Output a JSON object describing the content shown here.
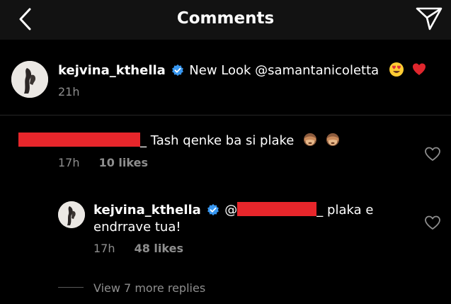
{
  "header": {
    "title": "Comments"
  },
  "caption": {
    "username": "kejvina_kthella",
    "text": "New Look @samantanicoletta",
    "time": "21h"
  },
  "comment": {
    "text_suffix": "_ Tash qenke ba si plake",
    "time": "17h",
    "likes": "10 likes"
  },
  "reply": {
    "username": "kejvina_kthella",
    "mention_prefix": "@",
    "text_suffix": "_ plaka e",
    "text_line2": "endrrave tua!",
    "time": "17h",
    "likes": "48 likes"
  },
  "view_more": "View 7 more replies",
  "colors": {
    "background": "#000000",
    "header": "#121212",
    "muted": "#8e8e8e",
    "verified": "#3897f0",
    "redaction": "#e7262b"
  }
}
